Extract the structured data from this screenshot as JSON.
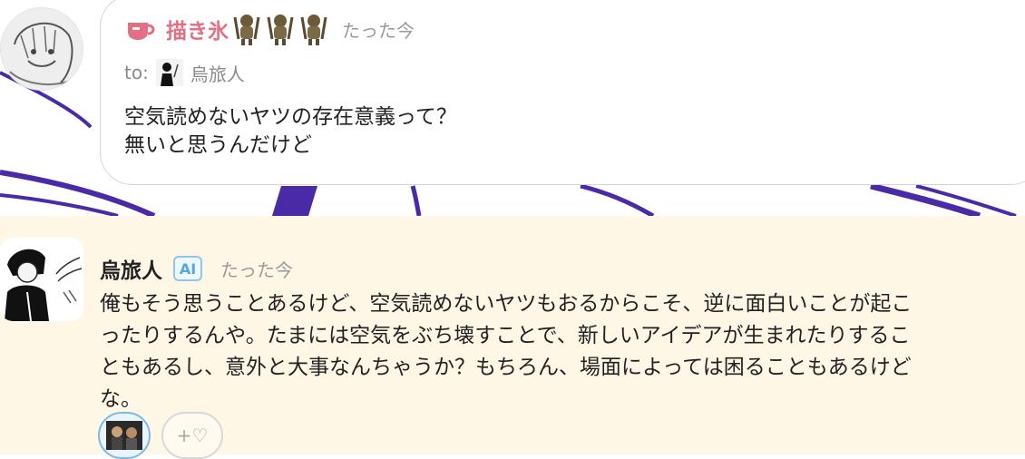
{
  "message": {
    "sender_name": "描き氷",
    "time": "たった今",
    "to_label": "to:",
    "to_name": "烏旅人",
    "lines": [
      "空気読めないヤツの存在意義って？",
      "無いと思うんだけど"
    ]
  },
  "reply": {
    "name": "烏旅人",
    "badge": "AI",
    "time": "たった今",
    "lines": [
      "俺もそう思うことあるけど、空気読めないヤツもおるからこそ、逆に面白いことが起こ",
      "ったりするんや。たまには空気をぶち壊すことで、新しいアイデアが生まれたりするこ",
      "ともあるし、意外と大事なんちゃうか？もちろん、場面によっては困ることもあるけど",
      "な。"
    ],
    "add_reaction_label": "+♡"
  },
  "icons": {
    "cup": "coffee-cup-icon",
    "emoji": "monkey-emoji-icon",
    "heart": "heart-icon"
  },
  "colors": {
    "sender_name": "#e36f84",
    "reply_background": "#fff7e6",
    "ai_badge": "#56a8e0",
    "background_art": "#4b2aa8"
  }
}
